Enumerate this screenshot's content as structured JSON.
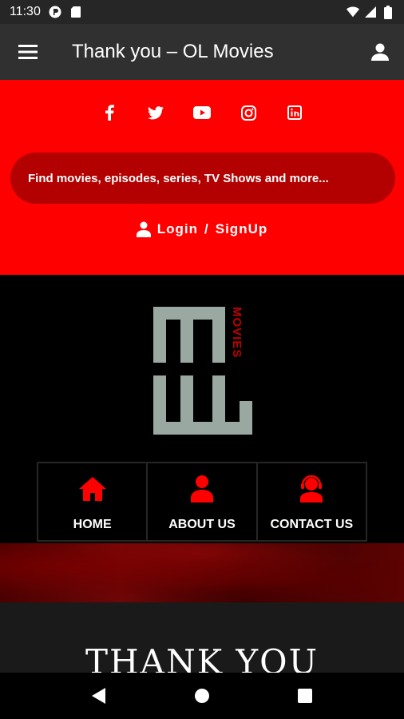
{
  "status_bar": {
    "time": "11:30"
  },
  "app_bar": {
    "title": "Thank you – OL Movies"
  },
  "social_links": [
    "facebook-icon",
    "twitter-icon",
    "youtube-icon",
    "instagram-icon",
    "linkedin-icon"
  ],
  "search": {
    "placeholder": "Find movies, episodes, series, TV Shows and more..."
  },
  "auth": {
    "login": "Login",
    "separator": "/",
    "signup": "SignUp"
  },
  "logo": {
    "text": "MOVIES"
  },
  "nav_tiles": [
    {
      "label": "HOME",
      "icon": "home-icon"
    },
    {
      "label": "ABOUT US",
      "icon": "user-icon"
    },
    {
      "label": "CONTACT US",
      "icon": "headset-icon"
    }
  ],
  "thanks": {
    "heading": "THANK YOU"
  },
  "colors": {
    "accent": "#ff0000",
    "search_bg": "#b30000",
    "appbar": "#303030",
    "logo_gray": "#9aa8a2"
  }
}
